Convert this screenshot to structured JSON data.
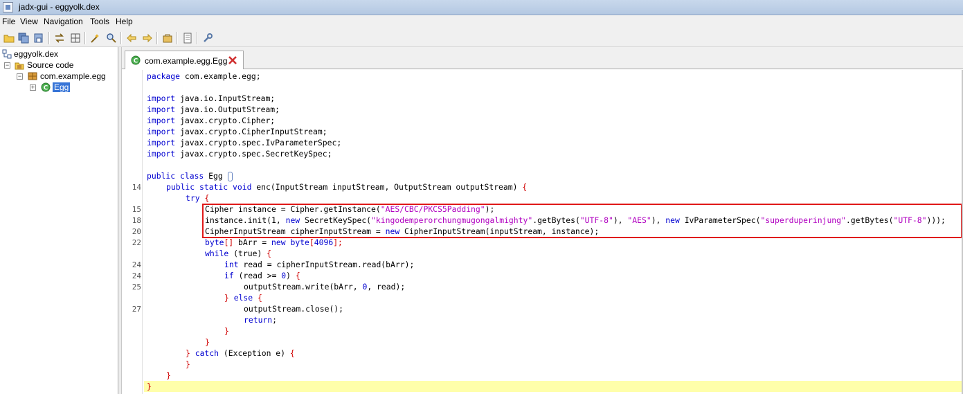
{
  "window": {
    "title": "jadx-gui - eggyolk.dex"
  },
  "menu": [
    "File",
    "View",
    "Navigation",
    "Tools",
    "Help"
  ],
  "toolbar": {
    "buttons": [
      {
        "name": "open-file-icon"
      },
      {
        "name": "save-all-icon"
      },
      {
        "name": "export-icon"
      },
      {
        "name": "sync-tree-icon"
      },
      {
        "name": "flatten-packages-icon"
      },
      {
        "name": "text-search-icon"
      },
      {
        "name": "class-search-icon"
      },
      {
        "name": "back-icon"
      },
      {
        "name": "forward-icon"
      },
      {
        "name": "deobfuscation-icon"
      },
      {
        "name": "log-viewer-icon"
      },
      {
        "name": "preferences-icon"
      }
    ]
  },
  "tree": {
    "root": "eggyolk.dex",
    "source": "Source code",
    "package": "com.example.egg",
    "class": "Egg"
  },
  "tabs": [
    {
      "label": "com.example.egg.Egg"
    }
  ],
  "editor": {
    "line_numbers": [
      "14",
      "15",
      "18",
      "20",
      "22",
      "24",
      "24",
      "25",
      "27"
    ],
    "lines": {
      "l1a": "package",
      "l1b": " com.example.egg;",
      "imp": "import",
      "i1": " java.io.InputStream;",
      "i2": " java.io.OutputStream;",
      "i3": " javax.crypto.Cipher;",
      "i4": " javax.crypto.CipherInputStream;",
      "i5": " javax.crypto.spec.IvParameterSpec;",
      "i6": " javax.crypto.spec.SecretKeySpec;",
      "cls_kw": "public class",
      "cls_name": " Egg ",
      "m_kw": "public static void",
      "m_rest": " enc(InputStream inputStream, OutputStream outputStream) ",
      "try_kw": "try",
      "c15a": "Cipher instance = Cipher.getInstance(",
      "c15s": "\"AES/CBC/PKCS5Padding\"",
      "c15b": ");",
      "c18a": "instance.init(1, ",
      "new": "new",
      "c18b": " SecretKeySpec(",
      "c18s1": "\"kingodemperorchungmugongalmighty\"",
      "c18c": ".getBytes(",
      "c18s2": "\"UTF-8\"",
      "c18d": "), ",
      "c18s3": "\"AES\"",
      "c18e": "), ",
      "c18f": " IvParameterSpec(",
      "c18s4": "\"superduperinjung\"",
      "c18g": ".getBytes(",
      "c18s5": "\"UTF-8\"",
      "c18h": ")));",
      "c20a": "CipherInputStream cipherInputStream = ",
      "c20b": " CipherInputStream(inputStream, instance);",
      "c22a": "byte",
      "c22b": "[]",
      "c22c": " bArr = ",
      "c22d": " byte",
      "c22e": "[",
      "c22f": "4096",
      "c22g": "];",
      "while_kw": "while",
      "while_rest": " (true) ",
      "int_kw": "int",
      "c24a": " read = cipherInputStream.read(bArr);",
      "if_kw": "if",
      "c24b": " (read >= ",
      "zero": "0",
      "c24c": ") ",
      "c25a": "outputStream.write(bArr, ",
      "c25b": ", read);",
      "else_kw": "else",
      "c27": "outputStream.close();",
      "return_kw": "return",
      "semicolon": ";",
      "catch_kw": "catch",
      "catch_rest": " (Exception e) ",
      "lbrace": "{",
      "rbrace": "}",
      "lparen": "(",
      "rparen": ")"
    }
  },
  "colors": {
    "keyword": "#0000d0",
    "string": "#b000c0",
    "brace": "#d00000",
    "highlight_box": "#e01818",
    "current_line": "#ffffaa"
  }
}
